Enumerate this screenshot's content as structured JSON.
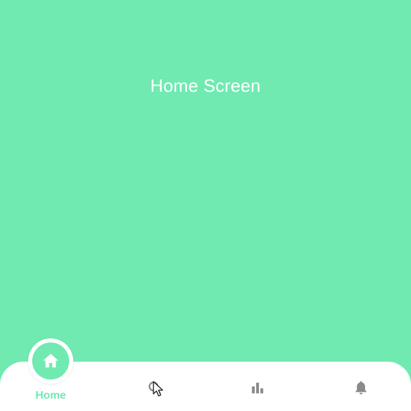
{
  "screen": {
    "title": "Home Screen"
  },
  "bottom_nav": {
    "items": [
      {
        "id": "home",
        "label": "Home",
        "icon": "home-icon",
        "active": true
      },
      {
        "id": "search",
        "label": "",
        "icon": "search-icon",
        "active": false
      },
      {
        "id": "stats",
        "label": "",
        "icon": "bar-chart-icon",
        "active": false
      },
      {
        "id": "notifications",
        "label": "",
        "icon": "bell-icon",
        "active": false
      }
    ]
  },
  "colors": {
    "accent": "#70eab1",
    "background": "#70eab1",
    "nav_background": "#ffffff",
    "inactive_icon": "#8a8a8a",
    "title_text": "#ffffff"
  }
}
